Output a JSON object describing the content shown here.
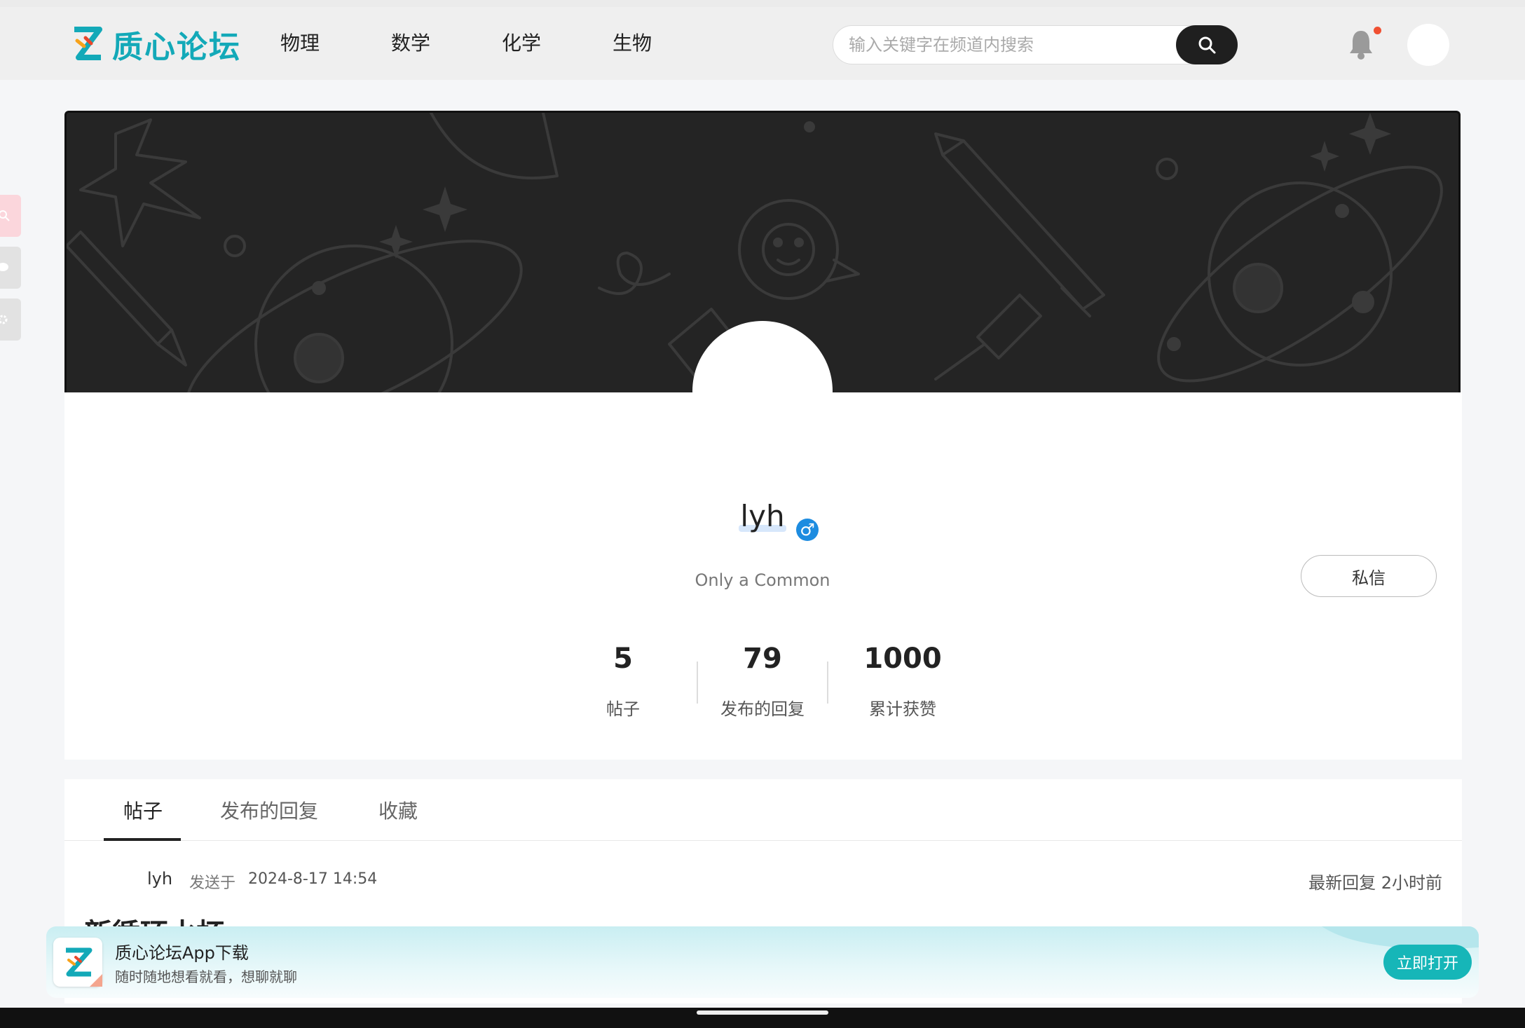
{
  "brand": {
    "name": "质心论坛"
  },
  "nav": {
    "items": [
      "物理",
      "数学",
      "化学",
      "生物"
    ]
  },
  "search": {
    "placeholder": "输入关键字在频道内搜索"
  },
  "profile": {
    "username": "lyh",
    "gender_symbol": "♂",
    "bio": "Only a Common",
    "dm_label": "私信",
    "stats": [
      {
        "value": "5",
        "label": "帖子"
      },
      {
        "value": "79",
        "label": "发布的回复"
      },
      {
        "value": "1000",
        "label": "累计获赞"
      }
    ]
  },
  "tabs": {
    "items": [
      "帖子",
      "发布的回复",
      "收藏"
    ],
    "active": "帖子"
  },
  "post": {
    "author": "lyh",
    "sent_label": "发送于",
    "time": "2024-8-17 14:54",
    "latest_reply": "最新回复 2小时前",
    "title_partial": "新循环水杯"
  },
  "app_banner": {
    "title": "质心论坛App下载",
    "subtitle": "随时随地想看就看，想聊就聊",
    "button": "立即打开"
  },
  "colors": {
    "brand": "#13a9b8",
    "notification_dot": "#f05032",
    "gender": "#1d8ce0",
    "open_button": "#16b6b8",
    "banner_bg": "#242424"
  }
}
